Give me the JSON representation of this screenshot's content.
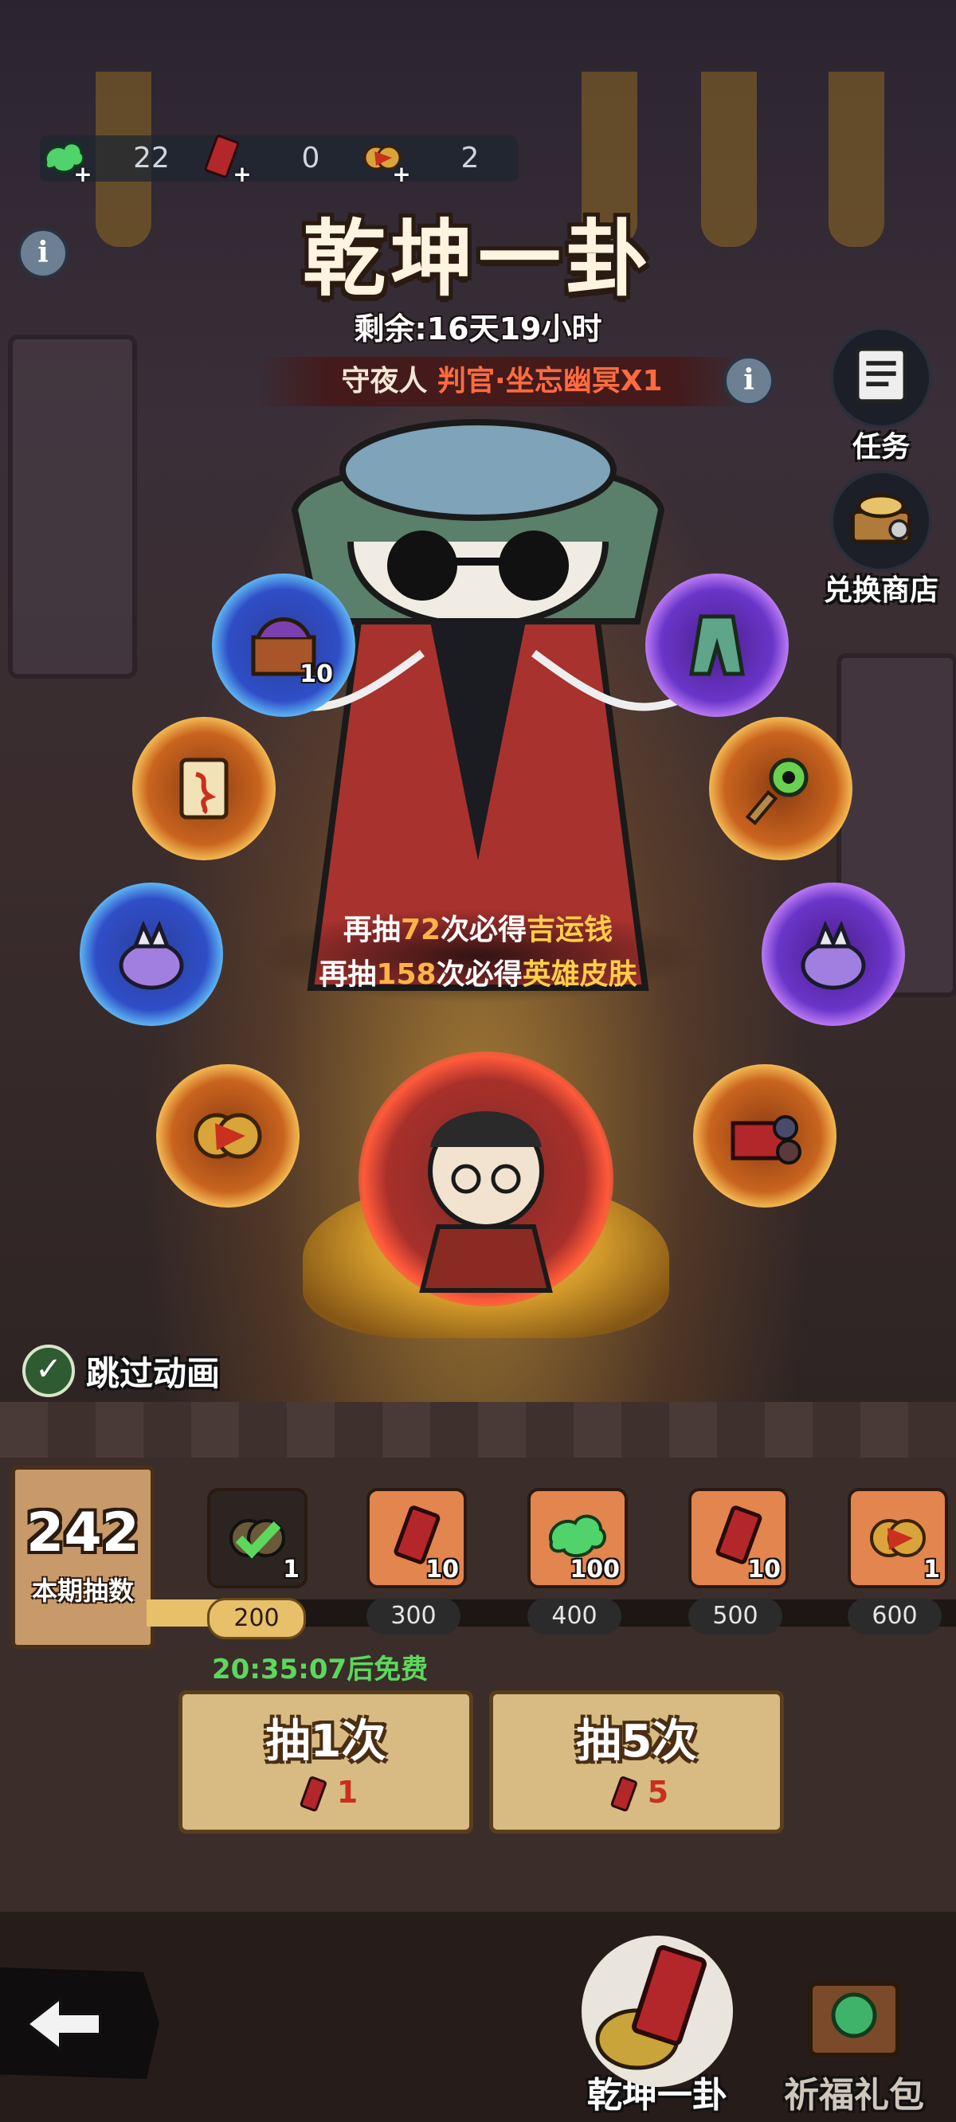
{
  "currencies": [
    {
      "icon": "jade-cloud-icon",
      "value": "22"
    },
    {
      "icon": "red-ticket-icon",
      "value": "0"
    },
    {
      "icon": "lucky-coin-icon",
      "value": "2"
    }
  ],
  "banner": {
    "title": "乾坤一卦",
    "remaining": "剩余:16天19小时",
    "feature_prefix": "守夜人",
    "feature_name": "判官·坐忘幽冥X1"
  },
  "side_buttons": [
    {
      "label": "任务",
      "icon": "scroll-task-icon"
    },
    {
      "label": "兑换商店",
      "icon": "treasure-shop-icon"
    }
  ],
  "orb_items": [
    {
      "icon": "treasure-chest-icon",
      "glow": "blue",
      "count": "10"
    },
    {
      "icon": "jade-robe-icon",
      "glow": "purple",
      "count": ""
    },
    {
      "icon": "red-scroll-icon",
      "glow": "orange",
      "count": ""
    },
    {
      "icon": "eye-key-icon",
      "glow": "orange",
      "count": ""
    },
    {
      "icon": "fox-pouch-icon",
      "glow": "blue",
      "count": ""
    },
    {
      "icon": "fox-pouch-icon",
      "glow": "purple",
      "count": ""
    },
    {
      "icon": "lucky-coin-icon",
      "glow": "orange",
      "count": ""
    },
    {
      "icon": "hero-chest-icon",
      "glow": "orange",
      "count": ""
    }
  ],
  "pity": {
    "line1_a": "再抽",
    "line1_n": "72",
    "line1_b": "次必得",
    "line1_g": "吉运钱",
    "line2_a": "再抽",
    "line2_n": "158",
    "line2_b": "次必得",
    "line2_g": "英雄皮肤"
  },
  "skip_animation": {
    "label": "跳过动画",
    "checked": true
  },
  "progress": {
    "count": "242",
    "count_label": "本期抽数",
    "fill_fraction": 0.135,
    "rewards": [
      {
        "milestone": "200",
        "qty": "1",
        "icon": "lucky-coin-icon",
        "claimed": true
      },
      {
        "milestone": "300",
        "qty": "10",
        "icon": "red-ticket-icon",
        "claimed": false
      },
      {
        "milestone": "400",
        "qty": "100",
        "icon": "jade-cloud-icon",
        "claimed": false
      },
      {
        "milestone": "500",
        "qty": "10",
        "icon": "red-ticket-icon",
        "claimed": false
      },
      {
        "milestone": "600",
        "qty": "1",
        "icon": "lucky-coin-icon",
        "claimed": false
      }
    ]
  },
  "free_timer": "20:35:07后免费",
  "draw_buttons": [
    {
      "label": "抽1次",
      "cost": "1",
      "cost_icon": "red-ticket-icon"
    },
    {
      "label": "抽5次",
      "cost": "5",
      "cost_icon": "red-ticket-icon"
    }
  ],
  "footer_tabs": [
    {
      "label": "乾坤一卦",
      "active": true
    },
    {
      "label": "祈福礼包",
      "active": false
    }
  ],
  "colors": {
    "accent_red": "#ff6b40",
    "pity_number": "#ffb347",
    "pity_reward": "#ffcf4a",
    "free_green": "#5cd85c",
    "progress_gold": "#e8c06a"
  }
}
